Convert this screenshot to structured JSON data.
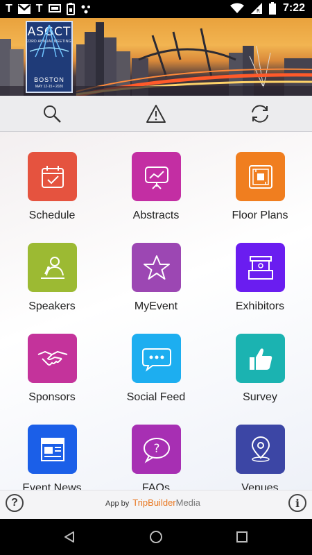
{
  "status_bar": {
    "left_icons": [
      "T",
      "gmail-icon",
      "T",
      "screen-icon",
      "battery-saver-icon",
      "assistant-icon"
    ],
    "time": "7:22"
  },
  "banner": {
    "logo_title": "ASGCT",
    "logo_subtitle": "23RD ANNUAL MEETING",
    "logo_city": "BOSTON",
    "logo_dates": "MAY 12-15 • 2020"
  },
  "toolbar": {
    "buttons": [
      "search-icon",
      "alert-icon",
      "refresh-icon"
    ]
  },
  "tiles": [
    {
      "label": "Schedule",
      "icon": "calendar-icon",
      "color": "#e5533f"
    },
    {
      "label": "Abstracts",
      "icon": "presentation-icon",
      "color": "#c32ea3"
    },
    {
      "label": "Floor Plans",
      "icon": "floorplan-icon",
      "color": "#f07e1f"
    },
    {
      "label": "Speakers",
      "icon": "speaker-icon",
      "color": "#9cba33"
    },
    {
      "label": "MyEvent",
      "icon": "star-icon",
      "color": "#9c47b3"
    },
    {
      "label": "Exhibitors",
      "icon": "booth-icon",
      "color": "#6a1df0"
    },
    {
      "label": "Sponsors",
      "icon": "handshake-icon",
      "color": "#c4339b"
    },
    {
      "label": "Social Feed",
      "icon": "chat-icon",
      "color": "#1daef0"
    },
    {
      "label": "Survey",
      "icon": "thumbs-up-icon",
      "color": "#1bb3b1"
    },
    {
      "label": "Event News",
      "icon": "newspaper-icon",
      "color": "#1b5fe8"
    },
    {
      "label": "FAQs",
      "icon": "question-bubble-icon",
      "color": "#a72fb3"
    },
    {
      "label": "Venues",
      "icon": "location-pin-icon",
      "color": "#3c46a5"
    }
  ],
  "footer": {
    "help": "?",
    "credit_prefix": "App by",
    "brand_part1": "TripBuilder",
    "brand_part2": "Media",
    "info": "i"
  }
}
